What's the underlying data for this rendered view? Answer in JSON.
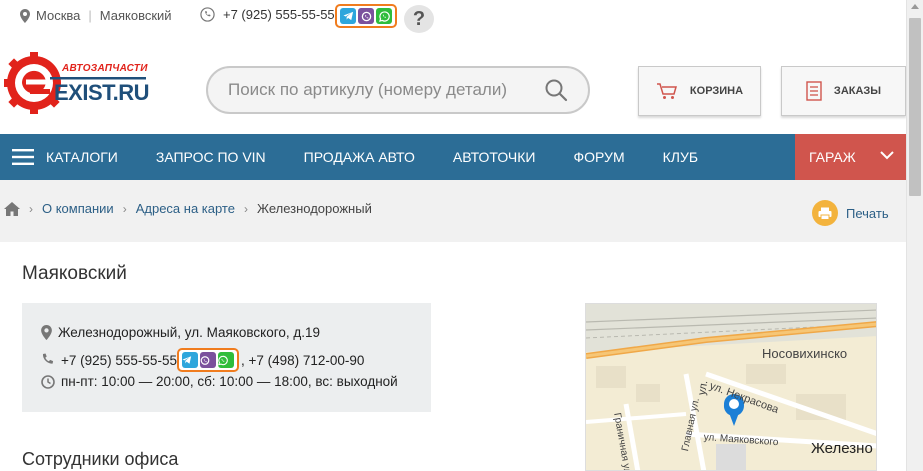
{
  "topbar": {
    "city": "Москва",
    "metro": "Маяковский",
    "phone": "+7 (925) 555-55-55",
    "help": "?"
  },
  "logo": {
    "tagline": "АВТОЗАПЧАСТИ",
    "name": "EXIST.RU",
    "brand_color": "#e1231b"
  },
  "search": {
    "placeholder": "Поиск по артикулу (номеру детали)"
  },
  "header": {
    "cart_label": "КОРЗИНА",
    "orders_label": "ЗАКАЗЫ"
  },
  "nav": {
    "items": [
      "КАТАЛОГИ",
      "ЗАПРОС ПО VIN",
      "ПРОДАЖА АВТО",
      "АВТОТОЧКИ",
      "ФОРУМ",
      "КЛУБ"
    ],
    "garage_label": "ГАРАЖ",
    "bg_color": "#2c6d96",
    "garage_color": "#d0554d"
  },
  "breadcrumb": {
    "items": [
      "О компании",
      "Адреса на карте"
    ],
    "current": "Железнодорожный",
    "print_label": "Печать"
  },
  "office": {
    "title": "Маяковский",
    "address": "Железнодорожный,  ул. Маяковского, д.19",
    "phone1": "+7 (925) 555-55-55",
    "phone2": ", +7 (498) 712-00-90",
    "hours": "пн-пт: 10:00 — 20:00, сб: 10:00 — 18:00, вс: выходной",
    "staff_title": "Сотрудники офиса"
  },
  "map": {
    "labels": {
      "nosovikhinskoe": "Носовихинско",
      "nekrasova": "ул. Некрасова",
      "glavnaya": "Главная ул.",
      "granichnaya": "Граничная ул.",
      "mayakovskogo": "ул. Маяковского",
      "gruzovaya": "ул.",
      "town": "Железно"
    }
  },
  "messengers": {
    "telegram_color": "#2ea6dc",
    "viber_color": "#7b519d",
    "whatsapp_color": "#2fbd3c",
    "highlight_color": "#f07c1e"
  }
}
